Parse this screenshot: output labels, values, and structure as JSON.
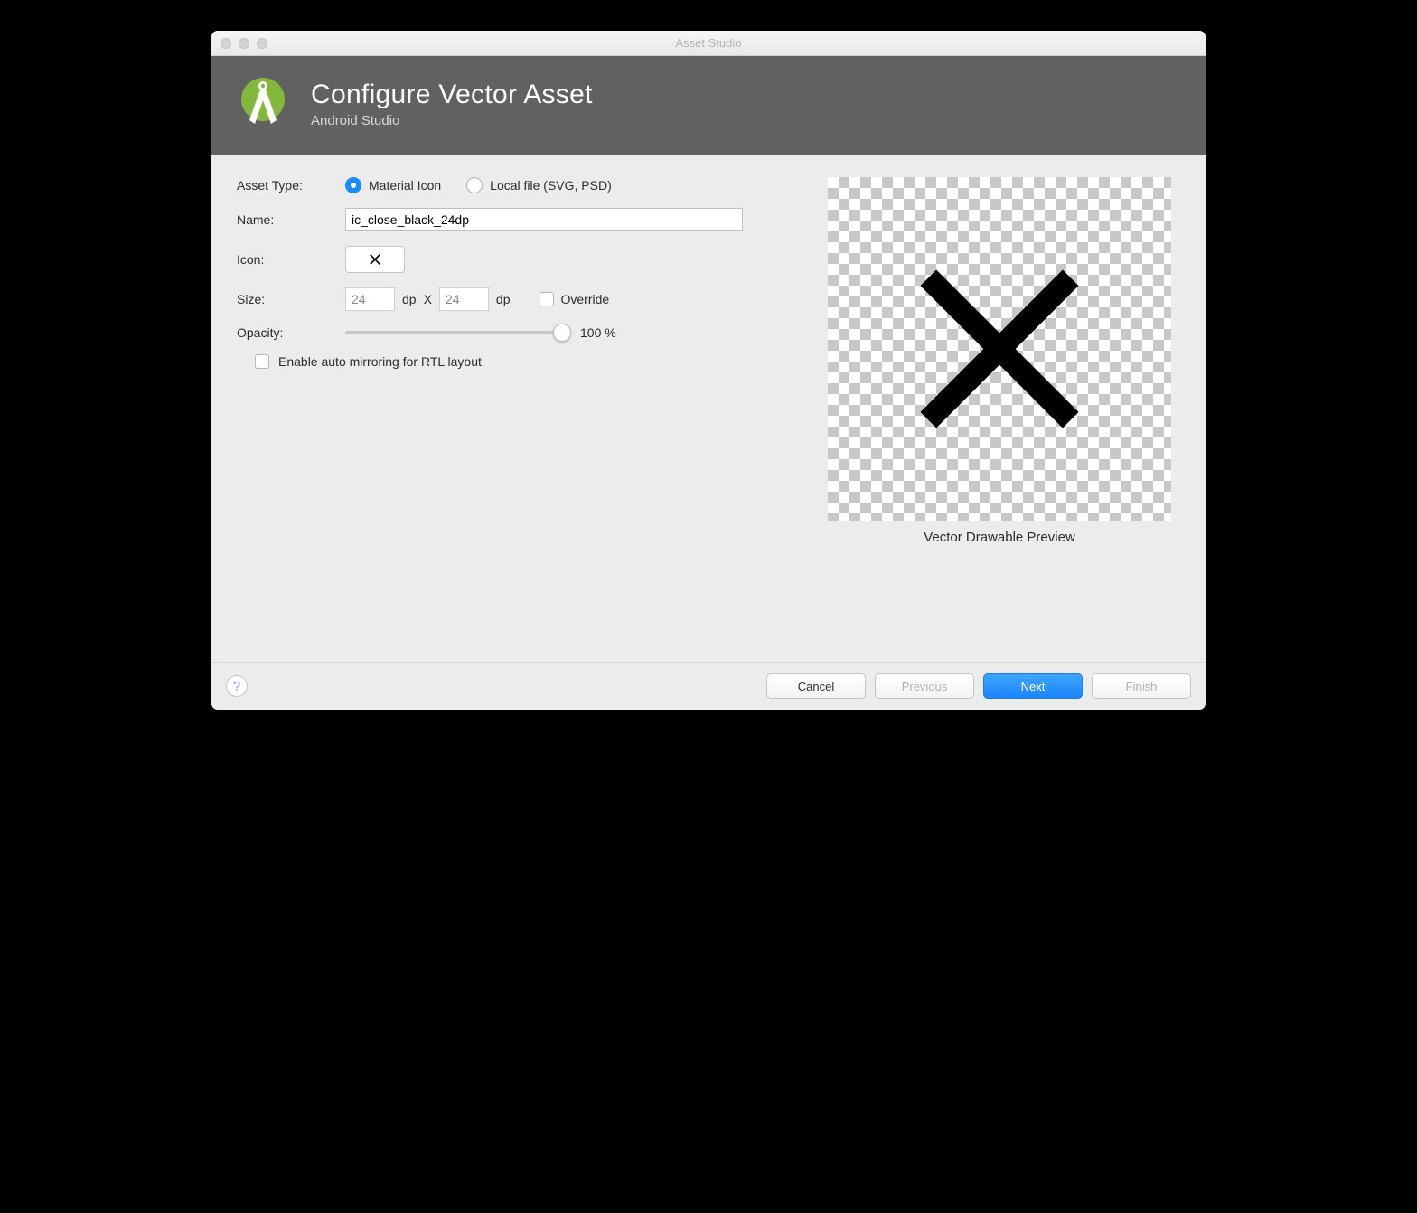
{
  "window": {
    "title": "Asset Studio"
  },
  "header": {
    "title": "Configure Vector Asset",
    "subtitle": "Android Studio"
  },
  "form": {
    "assetTypeLabel": "Asset Type:",
    "assetTypeOptions": {
      "material": "Material Icon",
      "local": "Local file (SVG, PSD)"
    },
    "nameLabel": "Name:",
    "nameValue": "ic_close_black_24dp",
    "iconLabel": "Icon:",
    "sizeLabel": "Size:",
    "sizeWidth": "24",
    "sizeUnit1": "dp",
    "sizeSep": "X",
    "sizeHeight": "24",
    "sizeUnit2": "dp",
    "overrideLabel": "Override",
    "opacityLabel": "Opacity:",
    "opacityValue": "100 %",
    "rtlLabel": "Enable auto mirroring for RTL layout"
  },
  "preview": {
    "caption": "Vector Drawable Preview"
  },
  "footer": {
    "help": "?",
    "cancel": "Cancel",
    "previous": "Previous",
    "next": "Next",
    "finish": "Finish"
  }
}
